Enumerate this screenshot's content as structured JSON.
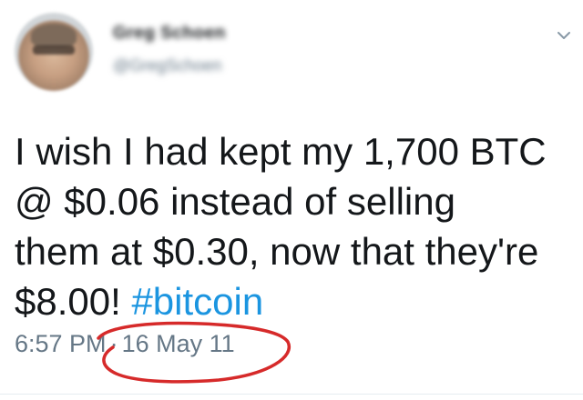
{
  "tweet": {
    "author_name": "Greg Schoen",
    "author_handle": "@GregSchoen",
    "text_line_1": "I wish I had kept my 1,700 BTC",
    "text_line_2": "@ $0.06 instead of selling",
    "text_line_3": "them at $0.30, now that they're",
    "text_line_4_prefix": "$8.00! ",
    "hashtag": "#bitcoin",
    "time": "6:57 PM",
    "separator": "·",
    "date": "16 May 11"
  },
  "icons": {
    "menu": "chevron-down-icon"
  },
  "colors": {
    "hashtag": "#1b95e0",
    "meta": "#657786",
    "annotation": "#d62a2a"
  }
}
